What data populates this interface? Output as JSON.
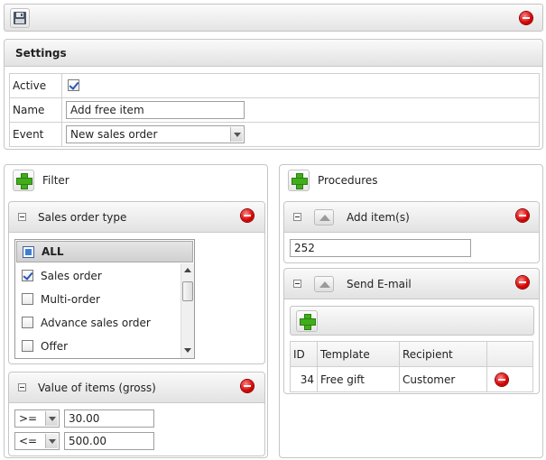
{
  "toolbar": {
    "save_icon": "floppy-disk-icon",
    "close_icon": "delete-icon"
  },
  "settings": {
    "title": "Settings",
    "rows": [
      {
        "label": "Active",
        "checked": true
      },
      {
        "label": "Name",
        "value": "Add free item"
      },
      {
        "label": "Event",
        "value": "New sales order"
      }
    ]
  },
  "filter": {
    "title": "Filter",
    "sales_order_type": {
      "title": "Sales order type",
      "options": [
        {
          "label": "ALL",
          "checked": false
        },
        {
          "label": "Sales order",
          "checked": true
        },
        {
          "label": "Multi-order",
          "checked": false
        },
        {
          "label": "Advance sales order",
          "checked": false
        },
        {
          "label": "Offer",
          "checked": false
        }
      ]
    },
    "value_of_items": {
      "title": "Value of items (gross)",
      "rows": [
        {
          "operator": ">=",
          "value": "30.00"
        },
        {
          "operator": "<=",
          "value": "500.00"
        }
      ]
    }
  },
  "procedures": {
    "title": "Procedures",
    "add_items": {
      "title": "Add item(s)",
      "value": "252"
    },
    "send_email": {
      "title": "Send E-mail",
      "columns": [
        "ID",
        "Template",
        "Recipient"
      ],
      "rows": [
        {
          "id": "34",
          "template": "Free gift",
          "recipient": "Customer"
        }
      ]
    }
  },
  "colors": {
    "accent_green": "#3fae1a",
    "delete_red": "#d60000",
    "selected_row": "#d8d8d8"
  }
}
